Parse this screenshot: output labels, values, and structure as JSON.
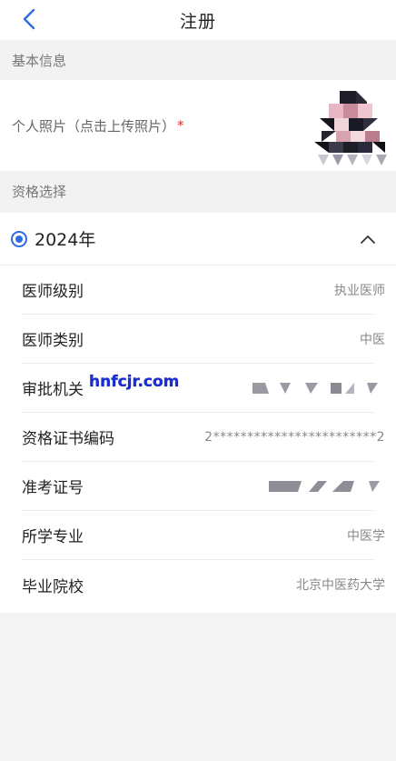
{
  "nav": {
    "title": "注册",
    "back_icon": "chevron-left-icon"
  },
  "sections": {
    "basic_info": "基本信息",
    "qualification": "资格选择"
  },
  "photo": {
    "label": "个人照片（点击上传照片）",
    "required_mark": "*"
  },
  "qualification": {
    "year": "2024年",
    "selected": true,
    "expanded": true,
    "rows": [
      {
        "label": "医师级别",
        "value": "执业医师"
      },
      {
        "label": "医师类别",
        "value": "中医"
      },
      {
        "label": "审批机关",
        "value": ""
      },
      {
        "label": "资格证书编码",
        "value": "2************************2"
      },
      {
        "label": "准考证号",
        "value": ""
      },
      {
        "label": "所学专业",
        "value": "中医学"
      },
      {
        "label": "毕业院校",
        "value": "北京中医药大学"
      }
    ]
  },
  "watermark": "hnfcjr.com",
  "colors": {
    "accent": "#2f6ce0",
    "required": "#d9302c",
    "watermark": "#1a2fd6"
  }
}
